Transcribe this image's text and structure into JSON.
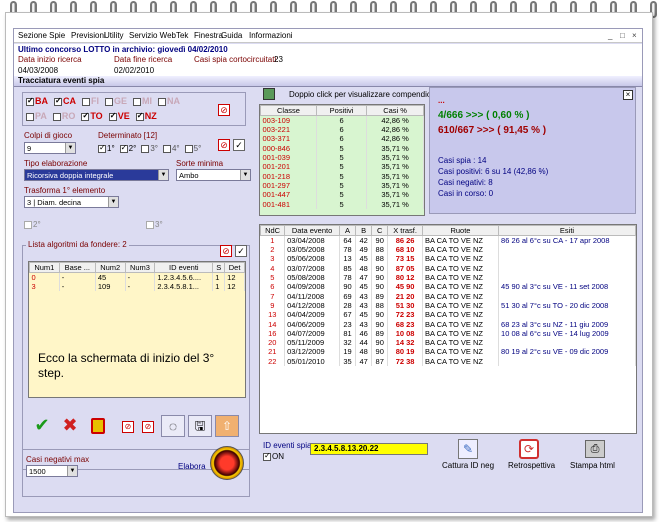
{
  "menu": [
    "Sezione Spie",
    "Previsioni",
    "Utility",
    "Servizio WebTek",
    "Finestra",
    "Guida",
    "Informazioni"
  ],
  "window_controls": {
    "min": "_",
    "restore": "□",
    "close": "×"
  },
  "info": {
    "title": "Ultimo concorso LOTTO in archivio: giovedì 04/02/2010",
    "start_label": "Data inizio ricerca",
    "end_label": "Data fine ricerca",
    "spie_label": "Casi spia cortocircuitati:",
    "spie_value": "23",
    "start_value": "04/03/2008",
    "end_value": "02/02/2010"
  },
  "panel_title": "Tracciatura eventi spia",
  "ruote_row1": [
    {
      "name": "BA",
      "checked": true
    },
    {
      "name": "CA",
      "checked": true
    },
    {
      "name": "FI",
      "checked": false
    },
    {
      "name": "GE",
      "checked": false
    },
    {
      "name": "MI",
      "checked": false
    },
    {
      "name": "NA",
      "checked": false
    }
  ],
  "ruote_row2": [
    {
      "name": "PA",
      "checked": false
    },
    {
      "name": "RO",
      "checked": false
    },
    {
      "name": "TO",
      "checked": true
    },
    {
      "name": "VE",
      "checked": true
    },
    {
      "name": "NZ",
      "checked": true
    }
  ],
  "colpi": {
    "label": "Colpi di gioco",
    "value": "9"
  },
  "determinato": {
    "label": "Determinato [12]",
    "opts": [
      {
        "n": "1°",
        "c": true
      },
      {
        "n": "2°",
        "c": true
      },
      {
        "n": "3°",
        "c": false
      },
      {
        "n": "4°",
        "c": false
      },
      {
        "n": "5°",
        "c": false
      }
    ]
  },
  "tipo": {
    "label": "Tipo elaborazione",
    "value": "Ricorsiva doppia integrale"
  },
  "sorte": {
    "label": "Sorte minima",
    "value": "Ambo"
  },
  "trasforma": {
    "label": "Trasforma 1° elemento",
    "value": "3 | Diam. decina"
  },
  "ord2": "2°",
  "ord3": "3°",
  "lista": {
    "label": "Lista algoritmi da fondere: 2",
    "headers": [
      "Num1",
      "Base ...",
      "Num2",
      "Num3",
      "ID eventi",
      "S",
      "Det"
    ],
    "rows": [
      [
        "0",
        "-",
        "45",
        "-",
        "1.2.3.4.5.6....",
        "1",
        "12"
      ],
      [
        "3",
        "-",
        "109",
        "-",
        "2.3.4.5.8.1...",
        "1",
        "12"
      ]
    ]
  },
  "overlay_text": "Ecco la schermata di inizio del 3° step.",
  "casi_neg": {
    "label": "Casi negativi max",
    "value": "1500"
  },
  "elabora": "Elabora",
  "classi": {
    "hint": "Doppio click per visualizzare compendio",
    "headers": [
      "Classe",
      "Positivi",
      "Casi %"
    ],
    "rows": [
      [
        "003-109",
        "6",
        "42,86 %"
      ],
      [
        "003-221",
        "6",
        "42,86 %"
      ],
      [
        "003-371",
        "6",
        "42,86 %"
      ],
      [
        "000-846",
        "5",
        "35,71 %"
      ],
      [
        "001-039",
        "5",
        "35,71 %"
      ],
      [
        "001-201",
        "5",
        "35,71 %"
      ],
      [
        "001-218",
        "5",
        "35,71 %"
      ],
      [
        "001-297",
        "5",
        "35,71 %"
      ],
      [
        "001-447",
        "5",
        "35,71 %"
      ],
      [
        "001-481",
        "5",
        "35,71 %"
      ]
    ]
  },
  "stats": {
    "dots": "...",
    "line1": "4/666 >>> ( 0,60 % )",
    "line2": "610/667 >>> ( 91,45 % )",
    "casi_spia": "Casi spia : 14",
    "casi_pos": "Casi positivi: 6 su 14 (42,86 %)",
    "casi_neg": "Casi negativi: 8",
    "casi_corso": "Casi in corso: 0"
  },
  "events": {
    "headers": [
      "NdC",
      "Data evento",
      "A",
      "B",
      "C",
      "X trasf.",
      "Ruote",
      "Esiti"
    ],
    "rows": [
      [
        "1",
        "03/04/2008",
        "64",
        "42",
        "90",
        "86 26",
        "BA CA TO VE NZ",
        "86 26 al 6°c su CA - 17 apr 2008"
      ],
      [
        "2",
        "03/05/2008",
        "78",
        "49",
        "88",
        "68 10",
        "BA CA TO VE NZ",
        ""
      ],
      [
        "3",
        "05/06/2008",
        "13",
        "45",
        "88",
        "73 15",
        "BA CA TO VE NZ",
        ""
      ],
      [
        "4",
        "03/07/2008",
        "85",
        "48",
        "90",
        "87 05",
        "BA CA TO VE NZ",
        ""
      ],
      [
        "5",
        "05/08/2008",
        "78",
        "47",
        "90",
        "80 12",
        "BA CA TO VE NZ",
        ""
      ],
      [
        "6",
        "04/09/2008",
        "90",
        "45",
        "90",
        "45 90",
        "BA CA TO VE NZ",
        "45 90 al 3°c su VE - 11 set 2008"
      ],
      [
        "7",
        "04/11/2008",
        "69",
        "43",
        "89",
        "21 20",
        "BA CA TO VE NZ",
        ""
      ],
      [
        "9",
        "04/12/2008",
        "28",
        "43",
        "88",
        "51 30",
        "BA CA TO VE NZ",
        "51 30 al 7°c su TO - 20 dic 2008"
      ],
      [
        "13",
        "04/04/2009",
        "67",
        "45",
        "90",
        "72 23",
        "BA CA TO VE NZ",
        ""
      ],
      [
        "14",
        "04/06/2009",
        "23",
        "43",
        "90",
        "68 23",
        "BA CA TO VE NZ",
        "68 23 al 3°c su NZ - 11 giu 2009"
      ],
      [
        "16",
        "04/07/2009",
        "81",
        "46",
        "89",
        "10 08",
        "BA CA TO VE NZ",
        "10 08 al 6°c su VE - 14 lug 2009"
      ],
      [
        "20",
        "05/11/2009",
        "32",
        "44",
        "90",
        "14 32",
        "BA CA TO VE NZ",
        ""
      ],
      [
        "21",
        "03/12/2009",
        "19",
        "48",
        "90",
        "80 19",
        "BA CA TO VE NZ",
        "80 19 al 2°c su VE - 09 dic 2009"
      ],
      [
        "22",
        "05/01/2010",
        "35",
        "47",
        "87",
        "72 38",
        "BA CA TO VE NZ",
        ""
      ]
    ]
  },
  "id_spia": {
    "label": "ID eventi spia",
    "value": "2.3.4.5.8.13.20.22",
    "on": "ON"
  },
  "bottom_btns": [
    "Cattura ID neg",
    "Retrospettiva",
    "Stampa html"
  ]
}
